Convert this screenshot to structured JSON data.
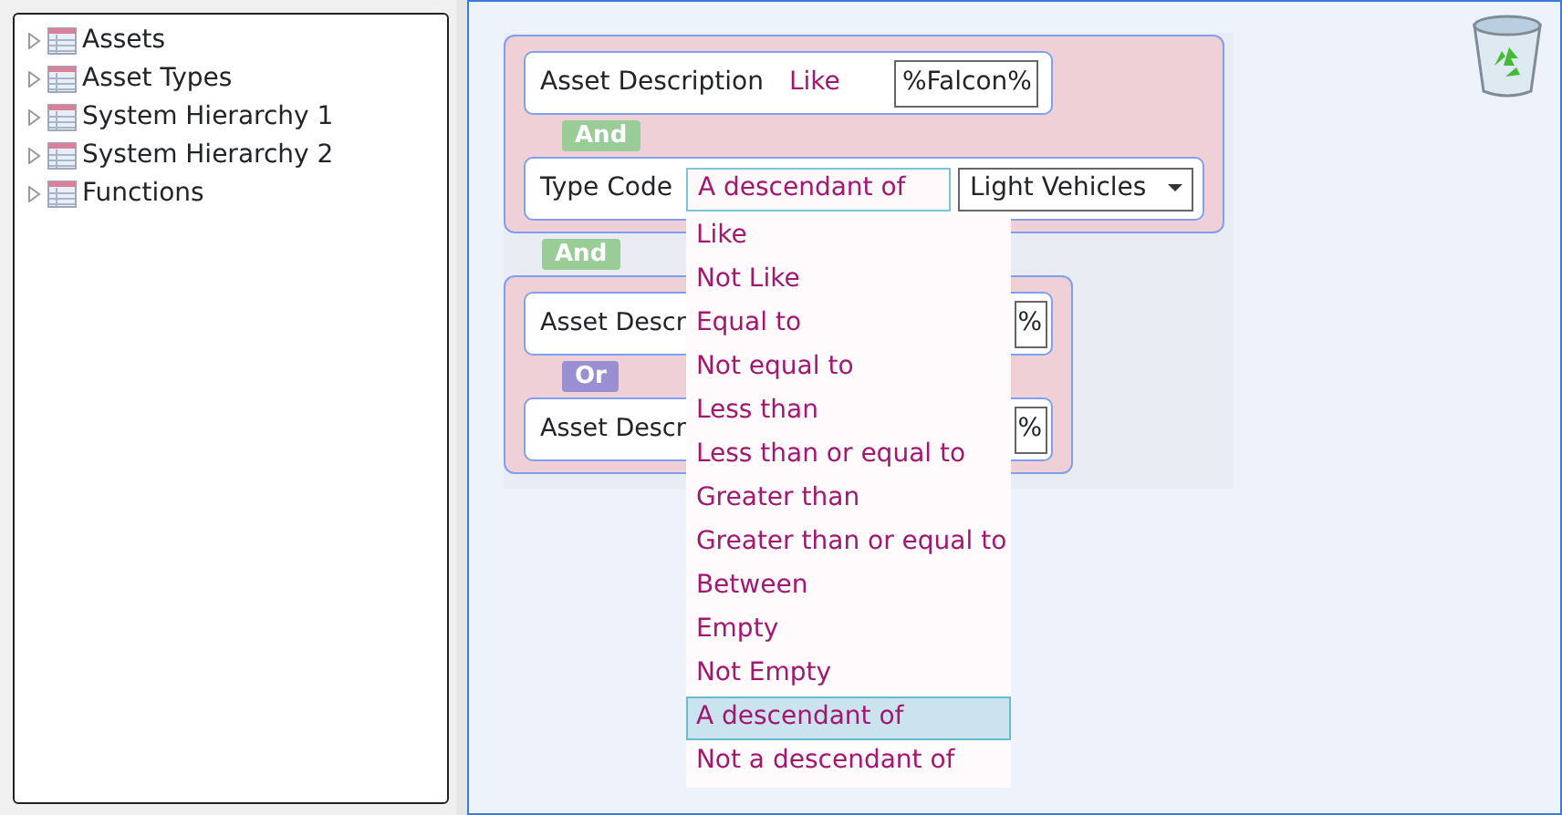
{
  "tree": [
    {
      "label": "Assets",
      "expanded": false
    },
    {
      "label": "Asset Types",
      "expanded": false
    },
    {
      "label": "System Hierarchy 1",
      "expanded": false
    },
    {
      "label": "System Hierarchy 2",
      "expanded": false
    },
    {
      "label": "Functions",
      "expanded": false
    }
  ],
  "query": [
    {
      "kind": "group",
      "items": [
        {
          "kind": "condition",
          "field": "Asset Description",
          "operator": "Like",
          "value": "%Falcon%"
        },
        {
          "kind": "connector",
          "label": "And",
          "color": "#99cc96"
        },
        {
          "kind": "condition",
          "field": "Type Code",
          "operator": "A descendant of",
          "select": "Light Vehicles",
          "menu": [
            {
              "label": "Like",
              "selected": false
            },
            {
              "label": "Not Like",
              "selected": false
            },
            {
              "label": "Equal to",
              "selected": false
            },
            {
              "label": "Not equal to",
              "selected": false
            },
            {
              "label": "Less than",
              "selected": false
            },
            {
              "label": "Less than or equal to",
              "selected": false
            },
            {
              "label": "Greater than",
              "selected": false
            },
            {
              "label": "Greater than or equal to",
              "selected": false
            },
            {
              "label": "Between",
              "selected": false
            },
            {
              "label": "Empty",
              "selected": false
            },
            {
              "label": "Not Empty",
              "selected": false
            },
            {
              "label": "A descendant of",
              "selected": true
            },
            {
              "label": "Not a descendant of",
              "selected": false
            }
          ]
        }
      ]
    },
    {
      "kind": "connector",
      "label": "And",
      "color": "#99cc96"
    },
    {
      "kind": "group",
      "items": [
        {
          "kind": "condition",
          "field": "Asset Descr",
          "value": "%"
        },
        {
          "kind": "connector",
          "label": "Or",
          "color": "#9b8fd3"
        },
        {
          "kind": "condition",
          "field": "Asset Descr",
          "value": "%"
        }
      ]
    }
  ]
}
